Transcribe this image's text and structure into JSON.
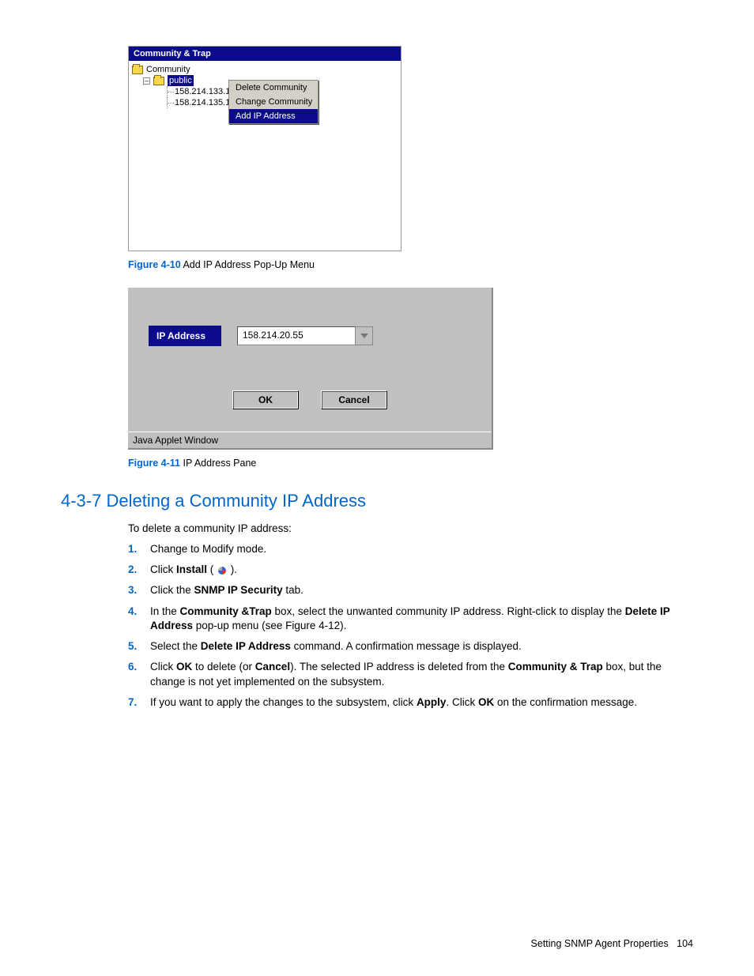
{
  "fig410": {
    "panel_title": "Community & Trap",
    "tree": {
      "root": "Community",
      "selected": "public",
      "ips": [
        "158.214.133.1",
        "158.214.135.1"
      ]
    },
    "context_menu": {
      "items": [
        "Delete Community",
        "Change Community",
        "Add IP Address"
      ],
      "highlighted_index": 2
    },
    "caption_label": "Figure 4-10",
    "caption_text": " Add IP Address Pop-Up Menu"
  },
  "fig411": {
    "ip_label": "IP Address",
    "ip_value": "158.214.20.55",
    "ok_label": "OK",
    "cancel_label": "Cancel",
    "status_text": "Java Applet Window",
    "caption_label": "Figure 4-11",
    "caption_text": " IP Address Pane"
  },
  "section": {
    "heading": "4-3-7 Deleting a Community IP Address",
    "intro": "To delete a community IP address:"
  },
  "steps": {
    "s1": "Change to Modify mode.",
    "s2_a": "Click ",
    "s2_b": "Install",
    "s2_c": " ( ",
    "s2_d": " ).",
    "s3_a": "Click the ",
    "s3_b": "SNMP IP Security",
    "s3_c": " tab.",
    "s4_a": "In the ",
    "s4_b": "Community &Trap",
    "s4_c": " box, select the unwanted community IP address. Right-click to display the ",
    "s4_d": "Delete IP Address",
    "s4_e": " pop-up menu (see Figure 4-12).",
    "s5_a": "Select the ",
    "s5_b": "Delete IP Address",
    "s5_c": " command. A confirmation message is displayed.",
    "s6_a": "Click ",
    "s6_b": "OK",
    "s6_c": " to delete (or ",
    "s6_d": "Cancel",
    "s6_e": "). The selected IP address is deleted from the ",
    "s6_f": "Community & Trap",
    "s6_g": " box, but the change is not yet implemented on the subsystem.",
    "s7_a": "If you want to apply the changes to the subsystem, click ",
    "s7_b": "Apply",
    "s7_c": ". Click ",
    "s7_d": "OK",
    "s7_e": " on the confirmation message."
  },
  "step_numbers": [
    "1.",
    "2.",
    "3.",
    "4.",
    "5.",
    "6.",
    "7."
  ],
  "footer": {
    "text": "Setting SNMP Agent Properties",
    "page": "104"
  }
}
